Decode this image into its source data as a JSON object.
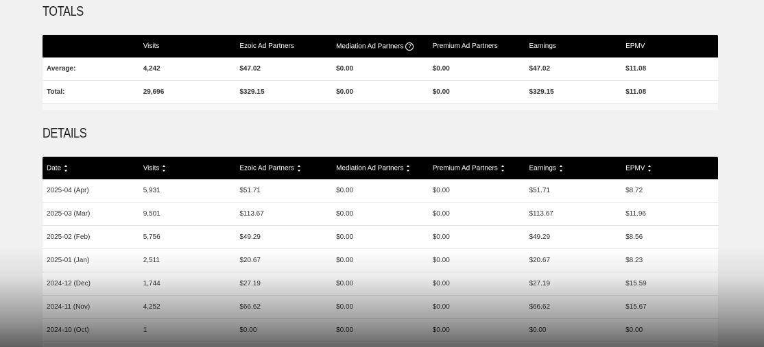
{
  "totals": {
    "title": "TOTALS",
    "headers": [
      "",
      "Visits",
      "Ezoic Ad Partners",
      "Mediation Ad Partners",
      "Premium Ad Partners",
      "Earnings",
      "EPMV"
    ],
    "rows": [
      [
        "Average:",
        "4,242",
        "$47.02",
        "$0.00",
        "$0.00",
        "$47.02",
        "$11.08"
      ],
      [
        "Total:",
        "29,696",
        "$329.15",
        "$0.00",
        "$0.00",
        "$329.15",
        "$11.08"
      ]
    ],
    "help_icon": "question-circle-icon"
  },
  "details": {
    "title": "DETAILS",
    "headers": [
      "Date",
      "Visits",
      "Ezoic Ad Partners",
      "Mediation Ad Partners",
      "Premium Ad Partners",
      "Earnings",
      "EPMV"
    ],
    "rows": [
      [
        "2025-04 (Apr)",
        "5,931",
        "$51.71",
        "$0.00",
        "$0.00",
        "$51.71",
        "$8.72"
      ],
      [
        "2025-03 (Mar)",
        "9,501",
        "$113.67",
        "$0.00",
        "$0.00",
        "$113.67",
        "$11.96"
      ],
      [
        "2025-02 (Feb)",
        "5,756",
        "$49.29",
        "$0.00",
        "$0.00",
        "$49.29",
        "$8.56"
      ],
      [
        "2025-01 (Jan)",
        "2,511",
        "$20.67",
        "$0.00",
        "$0.00",
        "$20.67",
        "$8.23"
      ],
      [
        "2024-12 (Dec)",
        "1,744",
        "$27.19",
        "$0.00",
        "$0.00",
        "$27.19",
        "$15.59"
      ],
      [
        "2024-11 (Nov)",
        "4,252",
        "$66.62",
        "$0.00",
        "$0.00",
        "$66.62",
        "$15.67"
      ],
      [
        "2024-10 (Oct)",
        "1",
        "$0.00",
        "$0.00",
        "$0.00",
        "$0.00",
        "$0.00"
      ]
    ],
    "sort_icon": "sort-icon"
  },
  "colors": {
    "header_bg": "#000000",
    "page_bg": "#f1f1f1"
  }
}
